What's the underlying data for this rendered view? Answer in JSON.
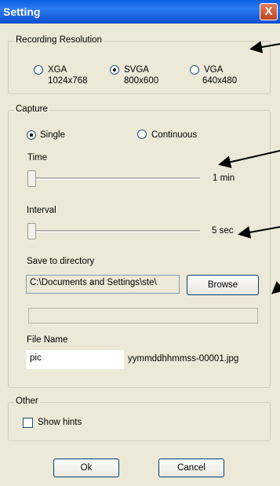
{
  "window": {
    "title": "Setting",
    "close_glyph": "X"
  },
  "recording_resolution": {
    "label": "Recording Resolution",
    "options": [
      {
        "name": "XGA",
        "size": "1024x768",
        "checked": false
      },
      {
        "name": "SVGA",
        "size": "800x600",
        "checked": true
      },
      {
        "name": "VGA",
        "size": "640x480",
        "checked": false
      }
    ]
  },
  "capture": {
    "label": "Capture",
    "modes": [
      {
        "label": "Single",
        "checked": true
      },
      {
        "label": "Continuous",
        "checked": false
      }
    ],
    "time": {
      "label": "Time",
      "value": "1 min"
    },
    "interval": {
      "label": "Interval",
      "value": "5 sec"
    },
    "save_dir": {
      "label": "Save to directory",
      "value": "C:\\Documents and Settings\\ste\\",
      "browse_label": "Browse"
    },
    "file_name": {
      "label": "File Name",
      "value": "pic",
      "suffix": "yymmddhhmmss-00001.jpg"
    }
  },
  "other": {
    "label": "Other",
    "show_hints": {
      "label": "Show hints",
      "checked": false
    }
  },
  "buttons": {
    "ok": "Ok",
    "cancel": "Cancel"
  }
}
